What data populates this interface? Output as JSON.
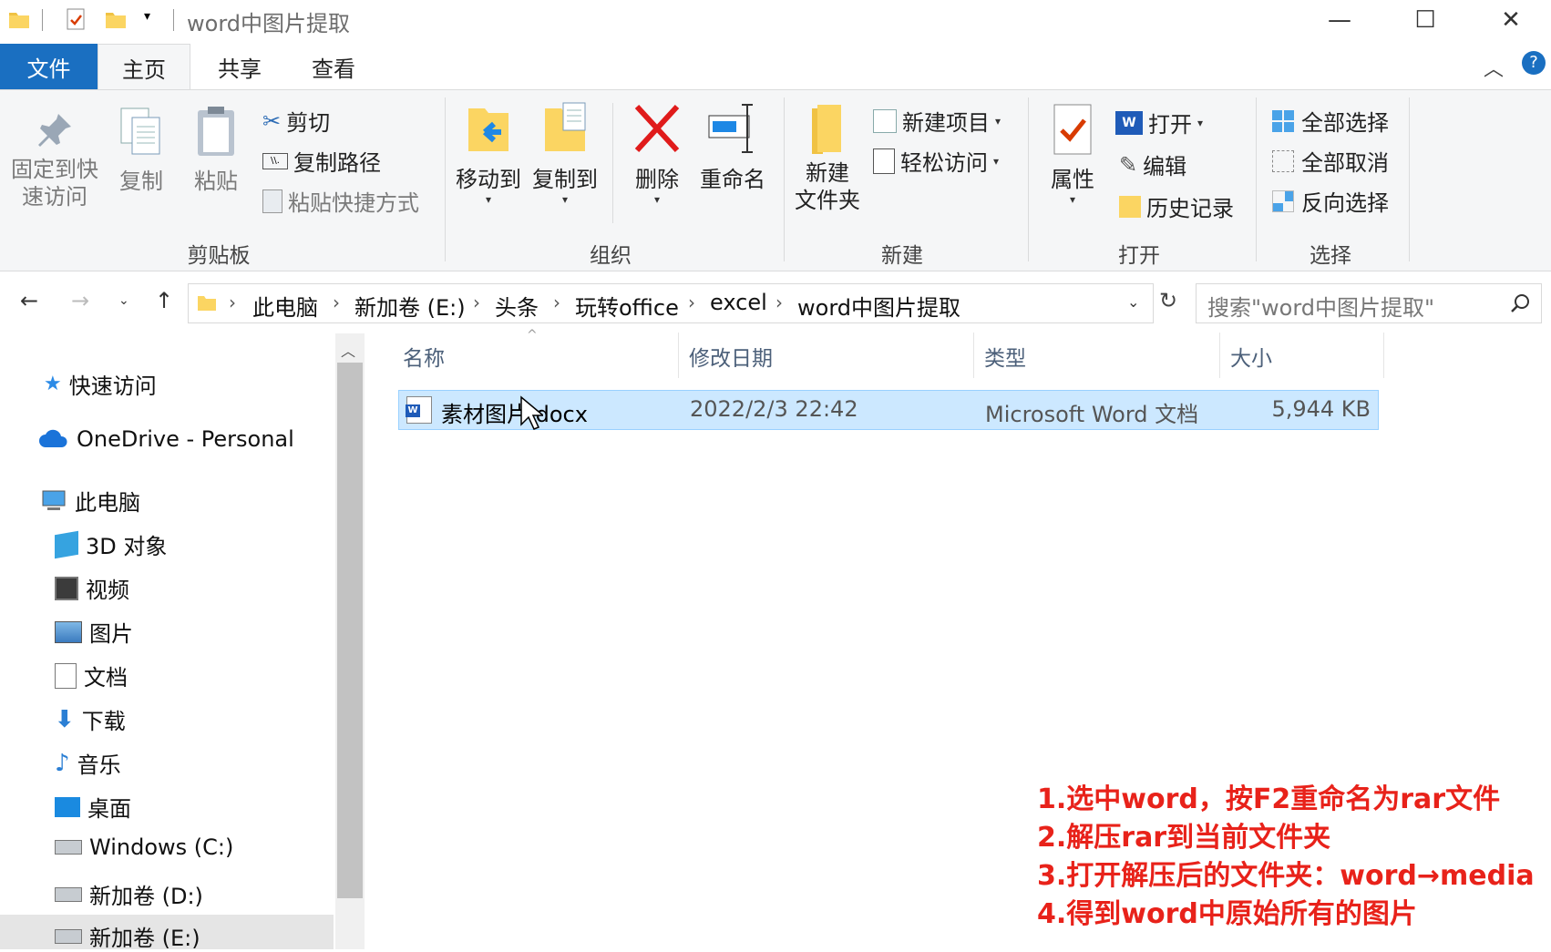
{
  "window": {
    "title": "word中图片提取",
    "minimize": "—",
    "maximize": "☐",
    "close": "✕"
  },
  "tabs": {
    "file": "文件",
    "home": "主页",
    "share": "共享",
    "view": "查看"
  },
  "ribbon": {
    "clipboard": {
      "pin": "固定到快\n速访问",
      "copy": "复制",
      "paste": "粘贴",
      "cut": "剪切",
      "copy_path": "复制路径",
      "paste_shortcut": "粘贴快捷方式",
      "group": "剪贴板"
    },
    "organize": {
      "move_to": "移动到",
      "copy_to": "复制到",
      "delete": "删除",
      "rename": "重命名",
      "group": "组织"
    },
    "new": {
      "new_folder": "新建\n文件夹",
      "new_item": "新建项目",
      "easy_access": "轻松访问",
      "group": "新建"
    },
    "open": {
      "properties": "属性",
      "open": "打开",
      "edit": "编辑",
      "history": "历史记录",
      "group": "打开"
    },
    "select": {
      "select_all": "全部选择",
      "select_none": "全部取消",
      "invert": "反向选择",
      "group": "选择"
    }
  },
  "address": {
    "crumbs": [
      "此电脑",
      "新加卷 (E:)",
      "头条",
      "玩转office",
      "excel",
      "word中图片提取"
    ],
    "search_placeholder": "搜索\"word中图片提取\""
  },
  "nav": {
    "quick_access": "快速访问",
    "onedrive": "OneDrive - Personal",
    "this_pc": "此电脑",
    "items": [
      "3D 对象",
      "视频",
      "图片",
      "文档",
      "下载",
      "音乐",
      "桌面",
      "Windows (C:)",
      "新加卷 (D:)",
      "新加卷 (E:)"
    ]
  },
  "list": {
    "headers": {
      "name": "名称",
      "date": "修改日期",
      "type": "类型",
      "size": "大小"
    },
    "files": [
      {
        "name": "素材图片.docx",
        "date": "2022/2/3 22:42",
        "type": "Microsoft Word 文档",
        "size": "5,944 KB"
      }
    ]
  },
  "notes": [
    "1.选中word，按F2重命名为rar文件",
    "2.解压rar到当前文件夹",
    "3.打开解压后的文件夹：word→media",
    "4.得到word中原始所有的图片"
  ],
  "colors": {
    "accent": "#1a6fc1",
    "selection": "#cce8ff",
    "note": "#e8221a"
  }
}
